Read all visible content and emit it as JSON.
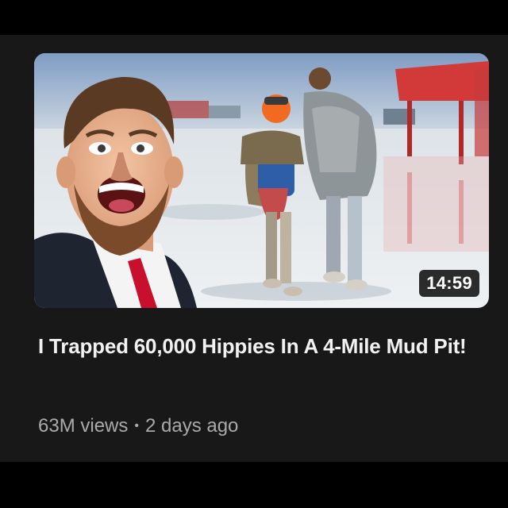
{
  "video": {
    "title": "I Trapped 60,000 Hippies In A 4-Mile Mud Pit!",
    "duration": "14:59",
    "views": "63M views",
    "separator": "•",
    "age": "2 days ago"
  },
  "thumbnail": {
    "subject": "creator-face-and-mud-walkers",
    "colors": {
      "sky": "#8fa9c8",
      "mud": "#dfe3e6",
      "suit": "#1e2430",
      "tie": "#c8102e",
      "helmet": "#f26a21",
      "backpack": "#2e5ea8",
      "tent": "#d23a3a"
    }
  },
  "theme": {
    "background": "#181818",
    "title_color": "#f1f1f1",
    "meta_color": "#aaaaaa"
  }
}
